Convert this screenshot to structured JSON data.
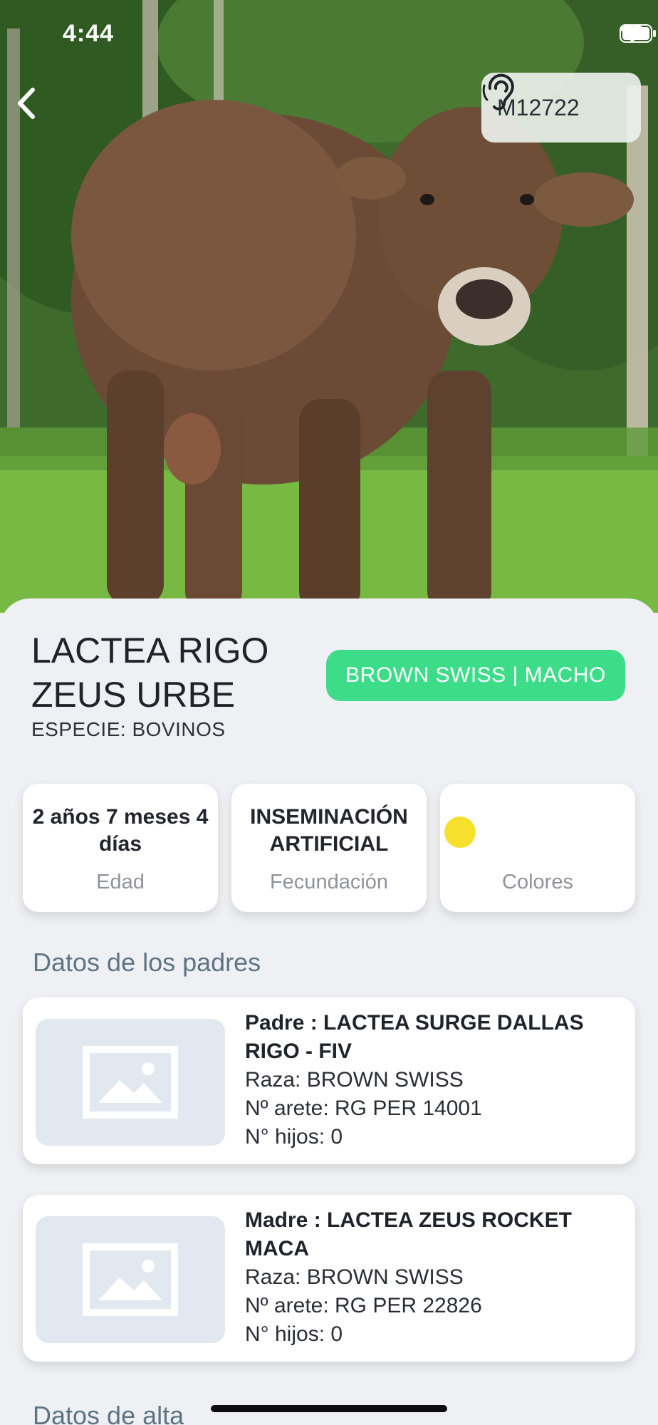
{
  "status_bar": {
    "time": "4:44"
  },
  "header": {
    "tag_id": "M12722"
  },
  "animal": {
    "name": "LACTEA RIGO ZEUS URBE",
    "species": "ESPECIE: BOVINOS",
    "breed_sex": "BROWN SWISS | MACHO"
  },
  "stats": [
    {
      "value": "2 años 7 meses 4 días",
      "label": "Edad"
    },
    {
      "value": "INSEMINACIÓN ARTIFICIAL",
      "label": "Fecundación"
    },
    {
      "value": "",
      "label": "Colores",
      "color": "#f7df2e"
    }
  ],
  "parents_section": {
    "title": "Datos de los padres",
    "parents": [
      {
        "name": "Padre : LACTEA SURGE DALLAS RIGO - FIV",
        "breed": "Raza: BROWN SWISS",
        "tag": "Nº arete: RG PER 14001",
        "children": "N° hijos:  0"
      },
      {
        "name": "Madre : LACTEA ZEUS ROCKET MACA",
        "breed": "Raza: BROWN SWISS",
        "tag": "Nº arete: RG PER 22826",
        "children": "N° hijos: 0"
      }
    ]
  },
  "registration_section": {
    "title": "Datos de alta"
  },
  "colors": {
    "accent_green": "#3ddc89",
    "section_title": "#5e7485",
    "placeholder_bg": "#e2e8ef"
  }
}
